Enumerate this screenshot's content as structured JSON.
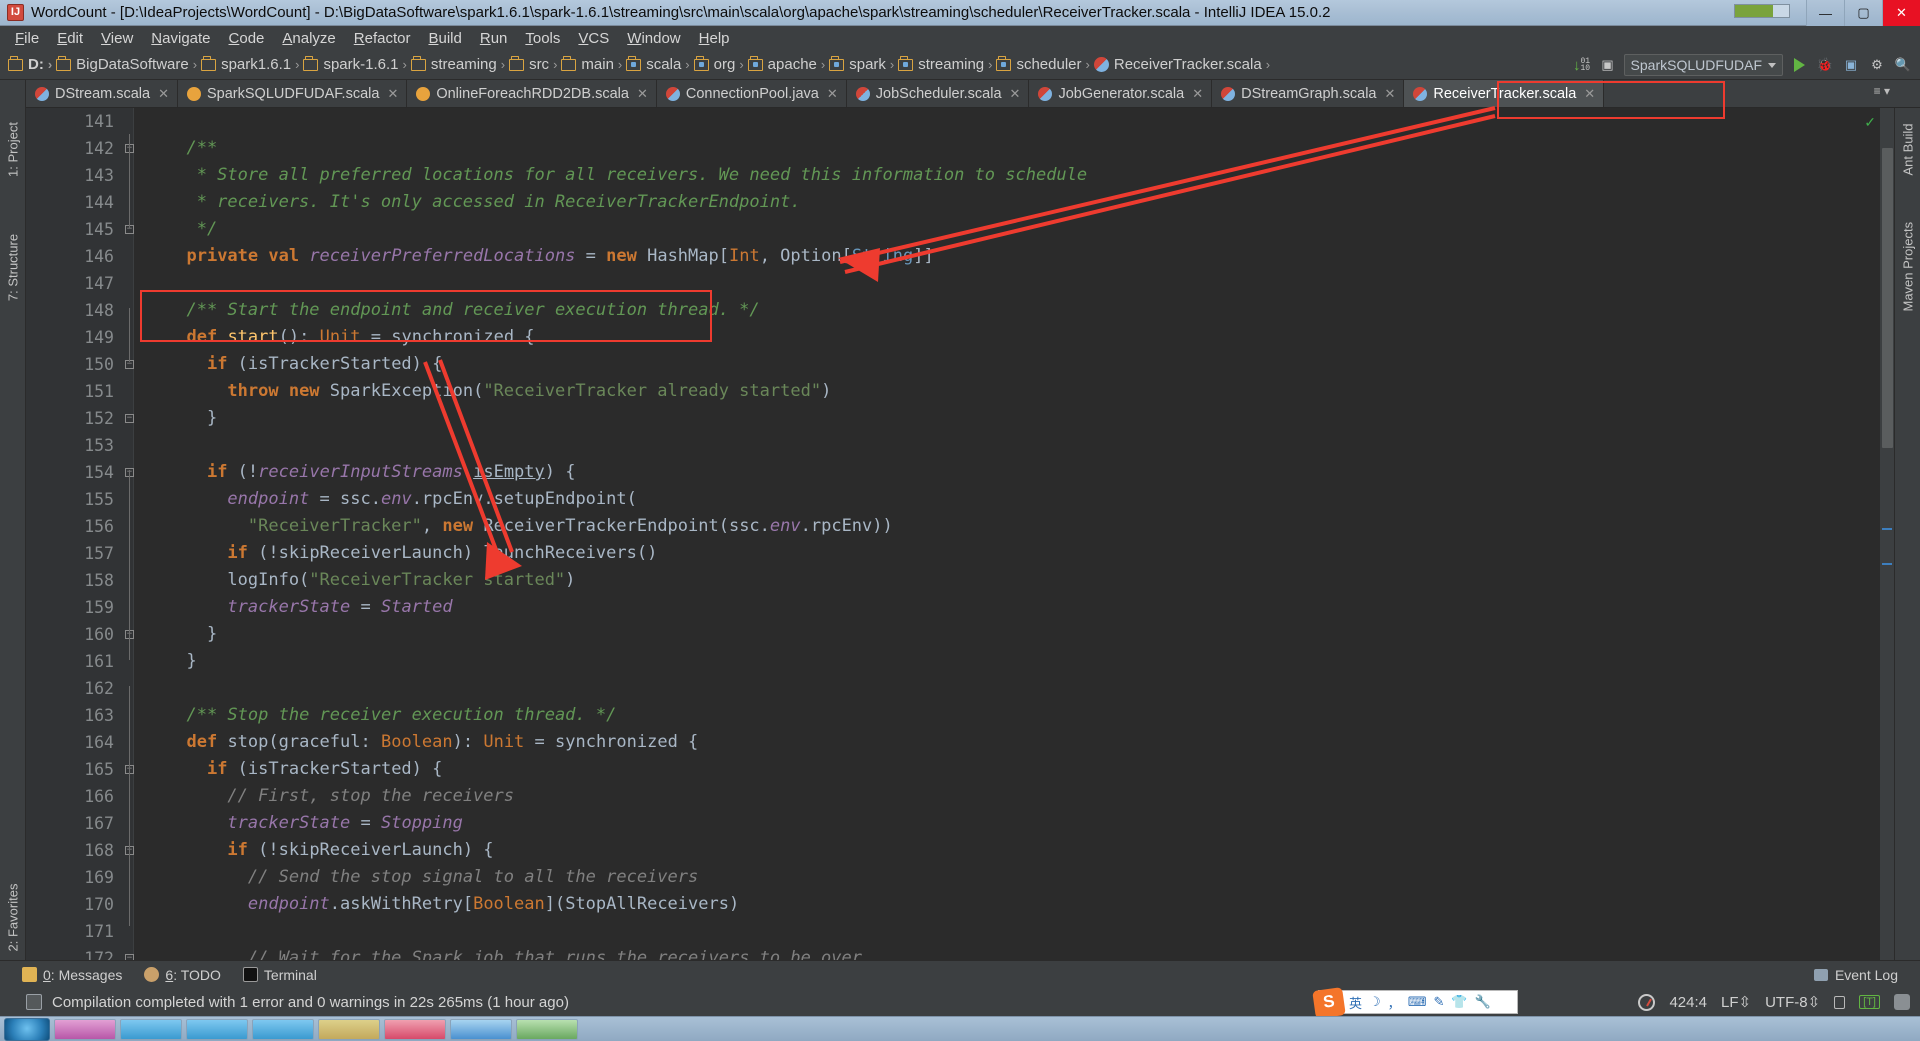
{
  "window": {
    "title": "WordCount - [D:\\IdeaProjects\\WordCount] - D:\\BigDataSoftware\\spark1.6.1\\spark-1.6.1\\streaming\\src\\main\\scala\\org\\apache\\spark\\streaming\\scheduler\\ReceiverTracker.scala - IntelliJ IDEA 15.0.2",
    "app_icon": "IJ",
    "minimize": "—",
    "maximize": "▢",
    "close": "✕"
  },
  "menubar": {
    "items": [
      "File",
      "Edit",
      "View",
      "Navigate",
      "Code",
      "Analyze",
      "Refactor",
      "Build",
      "Run",
      "Tools",
      "VCS",
      "Window",
      "Help"
    ]
  },
  "breadcrumb": {
    "items": [
      {
        "label": "D:",
        "icon": "folder-icon",
        "bold": true
      },
      {
        "label": "BigDataSoftware",
        "icon": "folder-icon",
        "bold": false
      },
      {
        "label": "spark1.6.1",
        "icon": "folder-icon",
        "bold": false
      },
      {
        "label": "spark-1.6.1",
        "icon": "folder-icon",
        "bold": false
      },
      {
        "label": "streaming",
        "icon": "folder-icon",
        "bold": false
      },
      {
        "label": "src",
        "icon": "folder-icon",
        "bold": false
      },
      {
        "label": "main",
        "icon": "folder-icon",
        "bold": false
      },
      {
        "label": "scala",
        "icon": "source-folder-icon",
        "bold": false
      },
      {
        "label": "org",
        "icon": "source-folder-icon",
        "bold": false
      },
      {
        "label": "apache",
        "icon": "source-folder-icon",
        "bold": false
      },
      {
        "label": "spark",
        "icon": "source-folder-icon",
        "bold": false
      },
      {
        "label": "streaming",
        "icon": "source-folder-icon",
        "bold": false
      },
      {
        "label": "scheduler",
        "icon": "source-folder-icon",
        "bold": false
      },
      {
        "label": "ReceiverTracker.scala",
        "icon": "scala-file-icon",
        "bold": false
      }
    ],
    "separator": "›"
  },
  "toolbar": {
    "run_config": "SparkSQLUDFUDAF",
    "run_label": "run-button",
    "debug_label": "debug-button",
    "coverage_label": "coverage-button",
    "settings_label": "settings-button",
    "search_label": "search-button",
    "download_label": "download-icon"
  },
  "tabs": [
    {
      "label": "DStream.scala",
      "icon": "scala",
      "active": false
    },
    {
      "label": "SparkSQLUDFUDAF.scala",
      "icon": "java",
      "active": false
    },
    {
      "label": "OnlineForeachRDD2DB.scala",
      "icon": "java",
      "active": false
    },
    {
      "label": "ConnectionPool.java",
      "icon": "scala",
      "active": false
    },
    {
      "label": "JobScheduler.scala",
      "icon": "scala",
      "active": false
    },
    {
      "label": "JobGenerator.scala",
      "icon": "scala",
      "active": false
    },
    {
      "label": "DStreamGraph.scala",
      "icon": "scala",
      "active": false
    },
    {
      "label": "ReceiverTracker.scala",
      "icon": "scala",
      "active": true
    }
  ],
  "left_strip": {
    "items": [
      "1: Project",
      "7: Structure",
      "2: Favorites"
    ]
  },
  "right_strip": {
    "items": [
      "Ant Build",
      "Maven Projects"
    ]
  },
  "editor": {
    "first_line": 141,
    "lines": [
      {
        "n": 141,
        "tokens": [],
        "fold": ""
      },
      {
        "n": 142,
        "tokens": [
          {
            "t": "  ",
            "c": "id"
          },
          {
            "t": "/**",
            "c": "cm"
          }
        ],
        "fold": "minus"
      },
      {
        "n": 143,
        "tokens": [
          {
            "t": "   * Store all preferred locations for all receivers. We need this information to schedule",
            "c": "cm"
          }
        ],
        "fold": ""
      },
      {
        "n": 144,
        "tokens": [
          {
            "t": "   * receivers. It's only accessed in ReceiverTrackerEndpoint.",
            "c": "cm"
          }
        ],
        "fold": ""
      },
      {
        "n": 145,
        "tokens": [
          {
            "t": "   */",
            "c": "cm"
          }
        ],
        "fold": "minus"
      },
      {
        "n": 146,
        "tokens": [
          {
            "t": "  ",
            "c": "id"
          },
          {
            "t": "private val ",
            "c": "kw"
          },
          {
            "t": "receiverPreferredLocations",
            "c": "fld"
          },
          {
            "t": " = ",
            "c": "id"
          },
          {
            "t": "new ",
            "c": "kw"
          },
          {
            "t": "HashMap[",
            "c": "id"
          },
          {
            "t": "Int",
            "c": "ty"
          },
          {
            "t": ", Option[",
            "c": "id"
          },
          {
            "t": "String",
            "c": "tyb"
          },
          {
            "t": "]]",
            "c": "id"
          }
        ],
        "fold": ""
      },
      {
        "n": 147,
        "tokens": [],
        "fold": ""
      },
      {
        "n": 148,
        "tokens": [
          {
            "t": "  ",
            "c": "id"
          },
          {
            "t": "/** Start the endpoint and receiver execution thread. */",
            "c": "cm"
          }
        ],
        "fold": ""
      },
      {
        "n": 149,
        "tokens": [
          {
            "t": "  ",
            "c": "id"
          },
          {
            "t": "def ",
            "c": "kw"
          },
          {
            "t": "start",
            "c": "fn"
          },
          {
            "t": "(): ",
            "c": "id"
          },
          {
            "t": "Unit",
            "c": "ty"
          },
          {
            "t": " = synchronized {",
            "c": "id"
          }
        ],
        "fold": ""
      },
      {
        "n": 150,
        "tokens": [
          {
            "t": "    ",
            "c": "id"
          },
          {
            "t": "if ",
            "c": "kw"
          },
          {
            "t": "(isTrackerStarted) {",
            "c": "id"
          }
        ],
        "fold": "minus"
      },
      {
        "n": 151,
        "tokens": [
          {
            "t": "      ",
            "c": "id"
          },
          {
            "t": "throw new ",
            "c": "kw"
          },
          {
            "t": "SparkException(",
            "c": "id"
          },
          {
            "t": "\"ReceiverTracker already started\"",
            "c": "st"
          },
          {
            "t": ")",
            "c": "id"
          }
        ],
        "fold": ""
      },
      {
        "n": 152,
        "tokens": [
          {
            "t": "    }",
            "c": "id"
          }
        ],
        "fold": "minus"
      },
      {
        "n": 153,
        "tokens": [],
        "fold": ""
      },
      {
        "n": 154,
        "tokens": [
          {
            "t": "    ",
            "c": "id"
          },
          {
            "t": "if ",
            "c": "kw"
          },
          {
            "t": "(!",
            "c": "id"
          },
          {
            "t": "receiverInputStreams",
            "c": "fld"
          },
          {
            "t": ".",
            "c": "id"
          },
          {
            "t": "isEmpty",
            "c": "mth"
          },
          {
            "t": ") {",
            "c": "id"
          }
        ],
        "fold": "minus"
      },
      {
        "n": 155,
        "tokens": [
          {
            "t": "      ",
            "c": "id"
          },
          {
            "t": "endpoint",
            "c": "fld"
          },
          {
            "t": " = ssc.",
            "c": "id"
          },
          {
            "t": "env",
            "c": "fld"
          },
          {
            "t": ".rpcEnv.setupEndpoint(",
            "c": "id"
          }
        ],
        "fold": ""
      },
      {
        "n": 156,
        "tokens": [
          {
            "t": "        ",
            "c": "id"
          },
          {
            "t": "\"ReceiverTracker\"",
            "c": "st"
          },
          {
            "t": ", ",
            "c": "id"
          },
          {
            "t": "new ",
            "c": "kw"
          },
          {
            "t": "ReceiverTrackerEndpoint(ssc.",
            "c": "id"
          },
          {
            "t": "env",
            "c": "fld"
          },
          {
            "t": ".rpcEnv))",
            "c": "id"
          }
        ],
        "fold": ""
      },
      {
        "n": 157,
        "tokens": [
          {
            "t": "      ",
            "c": "id"
          },
          {
            "t": "if ",
            "c": "kw"
          },
          {
            "t": "(!skipReceiverLaunch) launchReceivers()",
            "c": "id"
          }
        ],
        "fold": ""
      },
      {
        "n": 158,
        "tokens": [
          {
            "t": "      logInfo(",
            "c": "id"
          },
          {
            "t": "\"ReceiverTracker started\"",
            "c": "st"
          },
          {
            "t": ")",
            "c": "id"
          }
        ],
        "fold": ""
      },
      {
        "n": 159,
        "tokens": [
          {
            "t": "      ",
            "c": "id"
          },
          {
            "t": "trackerState",
            "c": "fld"
          },
          {
            "t": " = ",
            "c": "id"
          },
          {
            "t": "Started",
            "c": "fld"
          }
        ],
        "fold": ""
      },
      {
        "n": 160,
        "tokens": [
          {
            "t": "    }",
            "c": "id"
          }
        ],
        "fold": "minus"
      },
      {
        "n": 161,
        "tokens": [
          {
            "t": "  }",
            "c": "id"
          }
        ],
        "fold": ""
      },
      {
        "n": 162,
        "tokens": [],
        "fold": ""
      },
      {
        "n": 163,
        "tokens": [
          {
            "t": "  ",
            "c": "id"
          },
          {
            "t": "/** Stop the receiver execution thread. */",
            "c": "cm"
          }
        ],
        "fold": ""
      },
      {
        "n": 164,
        "tokens": [
          {
            "t": "  ",
            "c": "id"
          },
          {
            "t": "def ",
            "c": "kw"
          },
          {
            "t": "stop(graceful: ",
            "c": "id"
          },
          {
            "t": "Boolean",
            "c": "ty"
          },
          {
            "t": "): ",
            "c": "id"
          },
          {
            "t": "Unit",
            "c": "ty"
          },
          {
            "t": " = synchronized {",
            "c": "id"
          }
        ],
        "fold": ""
      },
      {
        "n": 165,
        "tokens": [
          {
            "t": "    ",
            "c": "id"
          },
          {
            "t": "if ",
            "c": "kw"
          },
          {
            "t": "(isTrackerStarted) {",
            "c": "id"
          }
        ],
        "fold": "minus"
      },
      {
        "n": 166,
        "tokens": [
          {
            "t": "      ",
            "c": "id"
          },
          {
            "t": "// First, stop the receivers",
            "c": "cm2"
          }
        ],
        "fold": ""
      },
      {
        "n": 167,
        "tokens": [
          {
            "t": "      ",
            "c": "id"
          },
          {
            "t": "trackerState",
            "c": "fld"
          },
          {
            "t": " = ",
            "c": "id"
          },
          {
            "t": "Stopping",
            "c": "fld"
          }
        ],
        "fold": ""
      },
      {
        "n": 168,
        "tokens": [
          {
            "t": "      ",
            "c": "id"
          },
          {
            "t": "if ",
            "c": "kw"
          },
          {
            "t": "(!skipReceiverLaunch) {",
            "c": "id"
          }
        ],
        "fold": "minus"
      },
      {
        "n": 169,
        "tokens": [
          {
            "t": "        ",
            "c": "id"
          },
          {
            "t": "// Send the stop signal to all the receivers",
            "c": "cm2"
          }
        ],
        "fold": ""
      },
      {
        "n": 170,
        "tokens": [
          {
            "t": "        ",
            "c": "id"
          },
          {
            "t": "endpoint",
            "c": "fld"
          },
          {
            "t": ".askWithRetry[",
            "c": "id"
          },
          {
            "t": "Boolean",
            "c": "ty"
          },
          {
            "t": "](StopAllReceivers)",
            "c": "id"
          }
        ],
        "fold": ""
      },
      {
        "n": 171,
        "tokens": [],
        "fold": ""
      },
      {
        "n": 172,
        "tokens": [
          {
            "t": "        ",
            "c": "id"
          },
          {
            "t": "// Wait for the Spark job that runs the receivers to be over",
            "c": "cm2"
          }
        ],
        "fold": "minus"
      }
    ]
  },
  "annotations": {
    "box_tab": "ReceiverTracker.scala",
    "box_code": "start method declaration"
  },
  "bottom_bar": {
    "items": [
      {
        "num": "0",
        "label": ": Messages",
        "icon": "messages-icon"
      },
      {
        "num": "6",
        "label": ": TODO",
        "icon": "todo-icon"
      },
      {
        "num": "",
        "label": "Terminal",
        "icon": "terminal-icon"
      }
    ],
    "event_log": "Event Log"
  },
  "status_bar": {
    "message": "Compilation completed with 1 error and 0 warnings in 22s 265ms (1 hour ago)",
    "caret": "424:4",
    "line_sep": "LF",
    "encoding": "UTF-8",
    "lock": "read-only-toggle",
    "tbracket": "[T]",
    "inspection": "inspection-gauge"
  },
  "ime": {
    "logo": "S",
    "items": [
      "英",
      "☽",
      "，",
      "⌨",
      "✎",
      "👕",
      "🔧"
    ]
  },
  "colors": {
    "editor_bg": "#2b2b2b",
    "gutter_bg": "#313335",
    "chrome_bg": "#3c3f41",
    "accent_red": "#ee3b2f",
    "comment_green": "#629755",
    "string_green": "#6a8759",
    "keyword_orange": "#cc7832",
    "field_purple": "#9876aa",
    "method_yellow": "#ffc66d",
    "title_blue": "#a8bed4"
  }
}
